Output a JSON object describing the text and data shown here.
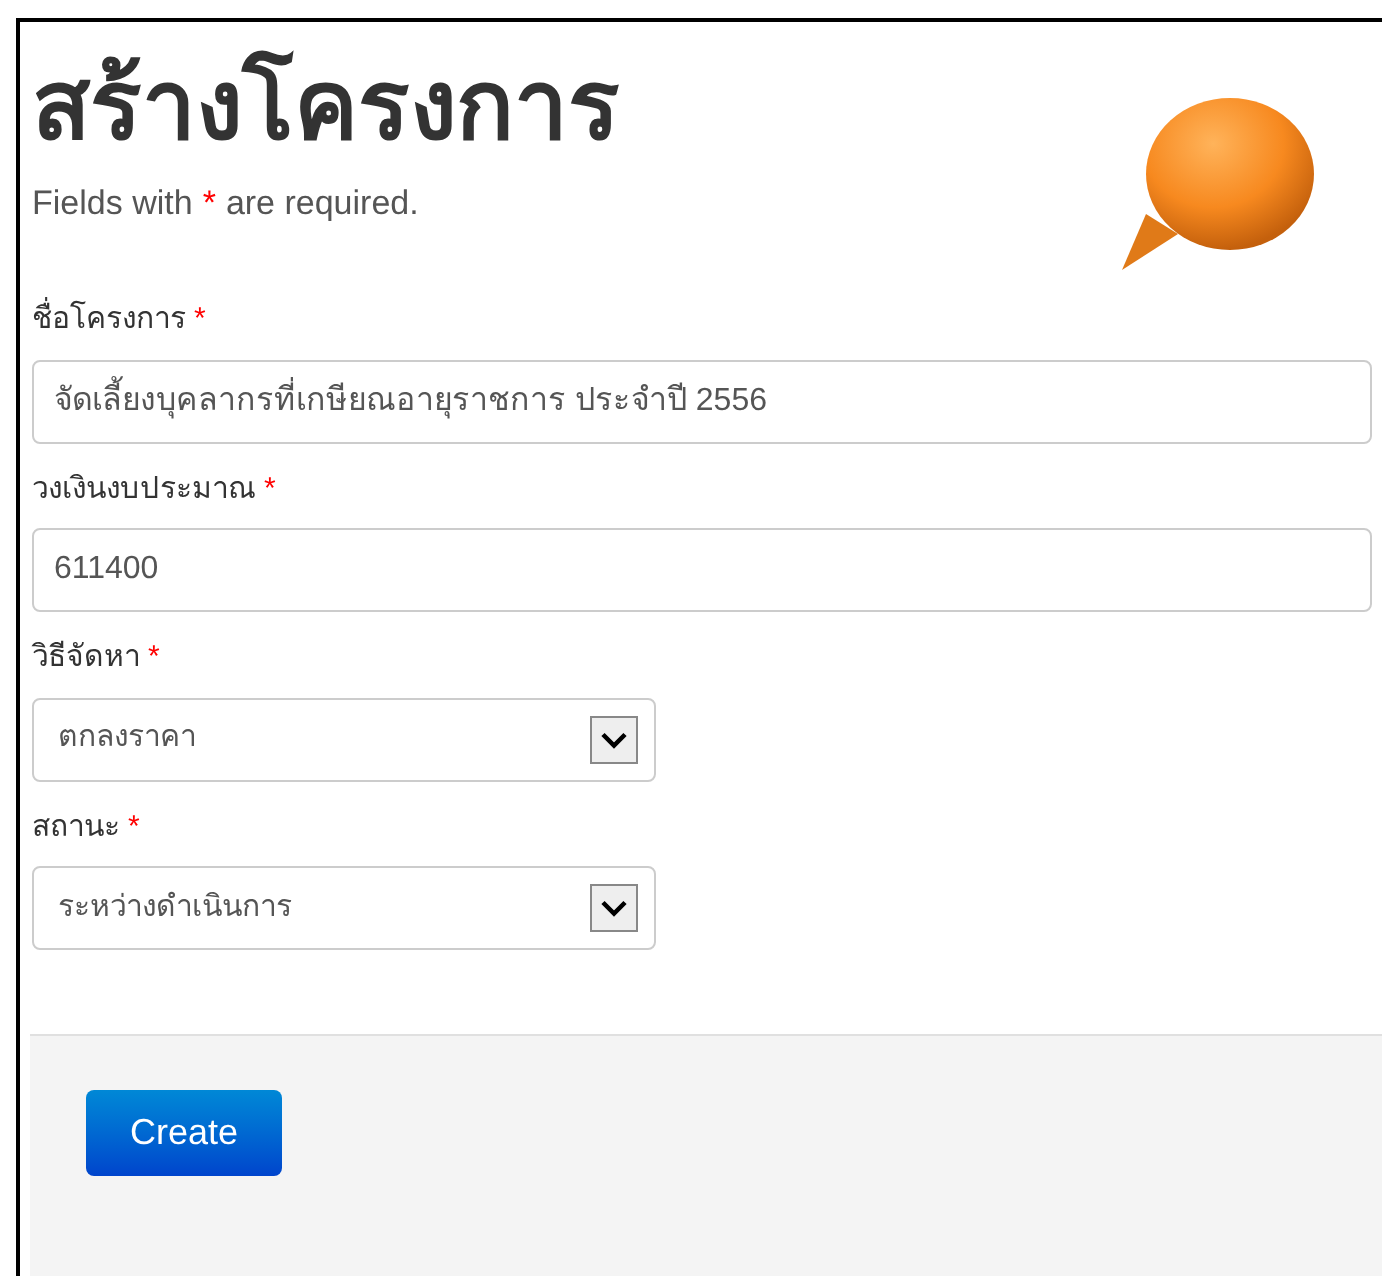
{
  "title": "สร้างโครงการ",
  "note": {
    "before": "Fields with",
    "mark": "*",
    "after": "are required."
  },
  "fields": [
    {
      "kind": "text",
      "label": "ชื่อโครงการ",
      "required_mark": "*",
      "value": "จัดเลี้ยงบุคลากรที่เกษียณอายุราชการ ประจำปี 2556"
    },
    {
      "kind": "text",
      "label": "วงเงินงบประมาณ",
      "required_mark": "*",
      "value": "611400"
    },
    {
      "kind": "select",
      "label": "วิธีจัดหา",
      "required_mark": "*",
      "value": "ตกลงราคา"
    },
    {
      "kind": "select",
      "label": "สถานะ",
      "required_mark": "*",
      "value": "ระหว่างดำเนินการ"
    }
  ],
  "submit": "Create"
}
